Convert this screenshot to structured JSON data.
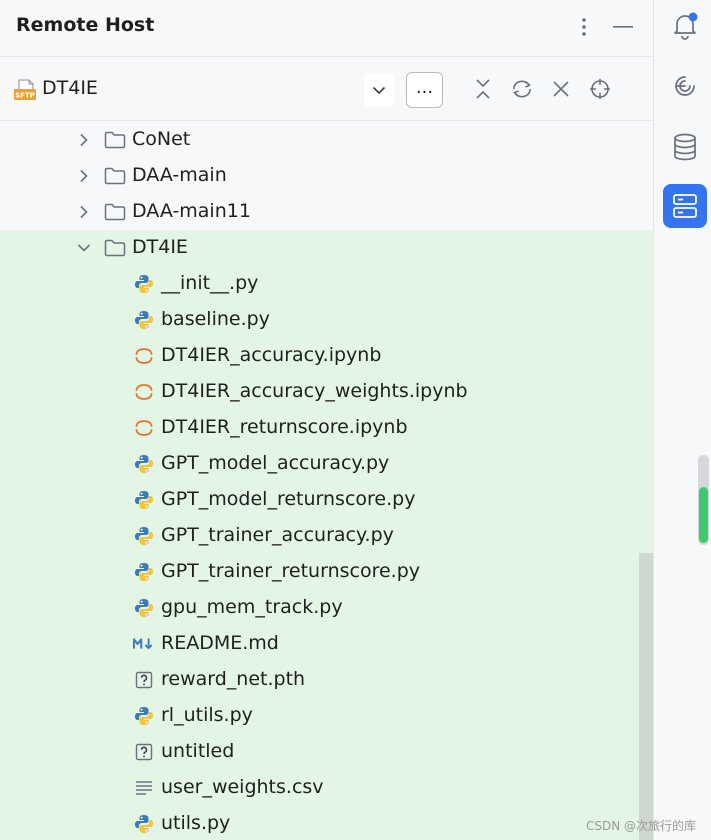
{
  "panel": {
    "title": "Remote Host",
    "host_name": "DT4IE",
    "sftp_badge": "SFTP",
    "more_label": "..."
  },
  "tree": [
    {
      "name": "CoNet",
      "kind": "folder",
      "expanded": false,
      "depth": 1
    },
    {
      "name": "DAA-main",
      "kind": "folder",
      "expanded": false,
      "depth": 1
    },
    {
      "name": "DAA-main11",
      "kind": "folder",
      "expanded": false,
      "depth": 1
    },
    {
      "name": "DT4IE",
      "kind": "folder",
      "expanded": true,
      "depth": 1,
      "selected": true
    },
    {
      "name": "__init__.py",
      "kind": "python",
      "depth": 2,
      "selected": true
    },
    {
      "name": "baseline.py",
      "kind": "python",
      "depth": 2,
      "selected": true
    },
    {
      "name": "DT4IER_accuracy.ipynb",
      "kind": "jupyter",
      "depth": 2,
      "selected": true
    },
    {
      "name": "DT4IER_accuracy_weights.ipynb",
      "kind": "jupyter",
      "depth": 2,
      "selected": true
    },
    {
      "name": "DT4IER_returnscore.ipynb",
      "kind": "jupyter",
      "depth": 2,
      "selected": true
    },
    {
      "name": "GPT_model_accuracy.py",
      "kind": "python",
      "depth": 2,
      "selected": true
    },
    {
      "name": "GPT_model_returnscore.py",
      "kind": "python",
      "depth": 2,
      "selected": true
    },
    {
      "name": "GPT_trainer_accuracy.py",
      "kind": "python",
      "depth": 2,
      "selected": true
    },
    {
      "name": "GPT_trainer_returnscore.py",
      "kind": "python",
      "depth": 2,
      "selected": true
    },
    {
      "name": "gpu_mem_track.py",
      "kind": "python",
      "depth": 2,
      "selected": true
    },
    {
      "name": "README.md",
      "kind": "markdown",
      "depth": 2,
      "selected": true
    },
    {
      "name": "reward_net.pth",
      "kind": "unknown",
      "depth": 2,
      "selected": true
    },
    {
      "name": "rl_utils.py",
      "kind": "python",
      "depth": 2,
      "selected": true
    },
    {
      "name": "untitled",
      "kind": "unknown",
      "depth": 2,
      "selected": true
    },
    {
      "name": "user_weights.csv",
      "kind": "text",
      "depth": 2,
      "selected": true
    },
    {
      "name": "utils.py",
      "kind": "python",
      "depth": 2,
      "selected": true
    }
  ],
  "sidebar": {
    "items": [
      {
        "icon": "notifications-icon",
        "has_badge": true,
        "active": false
      },
      {
        "icon": "ai-assistant-icon",
        "active": false
      },
      {
        "icon": "database-icon",
        "active": false
      },
      {
        "icon": "remote-host-icon",
        "active": true
      }
    ],
    "scroll_level": 0.65
  },
  "watermark": "CSDN @次旅行的库",
  "colors": {
    "accent": "#3574f0",
    "selection": "#e3f5e5",
    "jupyter": "#e8742a",
    "python_blue": "#3d7ab8",
    "python_yellow": "#f2c43a",
    "markdown": "#3d7ab8"
  }
}
